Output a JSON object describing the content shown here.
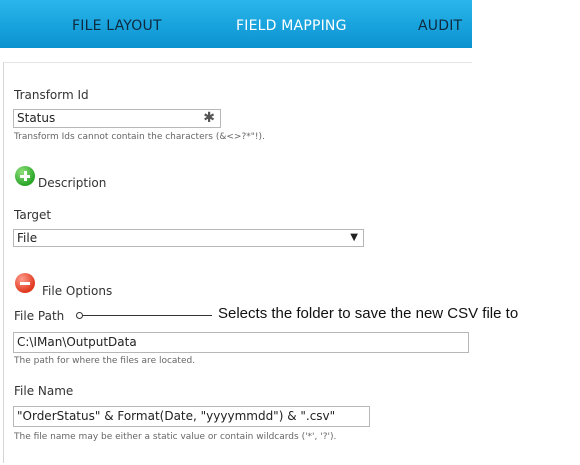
{
  "tabs": {
    "file_layout": "FILE LAYOUT",
    "field_mapping": "FIELD MAPPING",
    "audit": "AUDIT"
  },
  "transform_id": {
    "label": "Transform Id",
    "value": "Status",
    "hint": "Transform Ids cannot contain the characters (&<>?*\"!)."
  },
  "description": {
    "label": "Description"
  },
  "target": {
    "label": "Target",
    "value": "File"
  },
  "file_options": {
    "label": "File Options"
  },
  "file_path": {
    "label": "File Path",
    "value": "C:\\IMan\\OutputData",
    "hint": "The path for where the files are located.",
    "callout": "Selects the folder to save the new CSV file to"
  },
  "file_name": {
    "label": "File Name",
    "value": "\"OrderStatus\" & Format(Date, \"yyyymmdd\") & \".csv\"",
    "hint": "The file name may be either a static value or contain wildcards ('*', '?')."
  },
  "colors": {
    "topbar": "#1aa6e0",
    "tab_inactive": "#0d2a3f",
    "tab_active": "#ffffff",
    "add_icon": "#2aa52a",
    "remove_icon": "#e0381f"
  },
  "icons": {
    "required": "asterisk-icon",
    "add": "plus-circle-icon",
    "remove": "minus-circle-icon",
    "dropdown": "chevron-down-icon"
  }
}
